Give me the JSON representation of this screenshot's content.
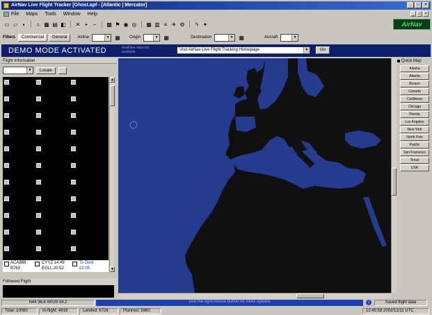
{
  "window": {
    "title": "AirNav Live Flight Tracker [Ghost.apf - [Atlantic | Mercator]",
    "controls": [
      "_",
      "□",
      "×"
    ]
  },
  "menu": {
    "items": [
      "File",
      "Maps",
      "Tools",
      "Window",
      "Help"
    ]
  },
  "brand": {
    "logo_text": "AirNav"
  },
  "filters": {
    "label": "Filters",
    "tabs": [
      "Commercial",
      "General"
    ],
    "airline_label": "Airline",
    "origin_label": "Origin",
    "destination_label": "Destination",
    "aircraft_label": "Aircraft"
  },
  "demo": {
    "banner": "DEMO MODE ACTIVATED",
    "subtext": "Realtime data not available",
    "url_value": "Visit AirNav Live Flight Tracking Homepage",
    "go_label": "Go"
  },
  "left_panel": {
    "header": "Flight Information",
    "locate_label": "Locate",
    "highlighted_flight": {
      "callsign": "ACA888",
      "aircraft": "B763",
      "origin": "CYYZ 14:49",
      "destination": "EGLL 20:52",
      "status": "To Dest",
      "eta": "02:05"
    },
    "followed_header": "Followed Flight"
  },
  "map": {
    "ocean_color": "#243b8e",
    "land_color": "#101010"
  },
  "quick_map": {
    "header": "Quick Map",
    "items": [
      "Alaska",
      "Atlanta",
      "Boston",
      "Canada",
      "Caribbean",
      "Chicago",
      "Florida",
      "Los Angeles",
      "New York",
      "North Pole",
      "Pacific",
      "San Francisco",
      "Texas",
      "USA"
    ]
  },
  "status": {
    "coords": "N44 36.6 W029 04.2",
    "hint": "Use the right mouse button for more options",
    "saved": "Saved flight data",
    "total": "Total: 10060",
    "inflight": "In-flight: 4816",
    "landed": "Landed: 6726",
    "planned": "Planned: 5960",
    "datetime": "12:45:58 2002/12/11 UTC"
  }
}
